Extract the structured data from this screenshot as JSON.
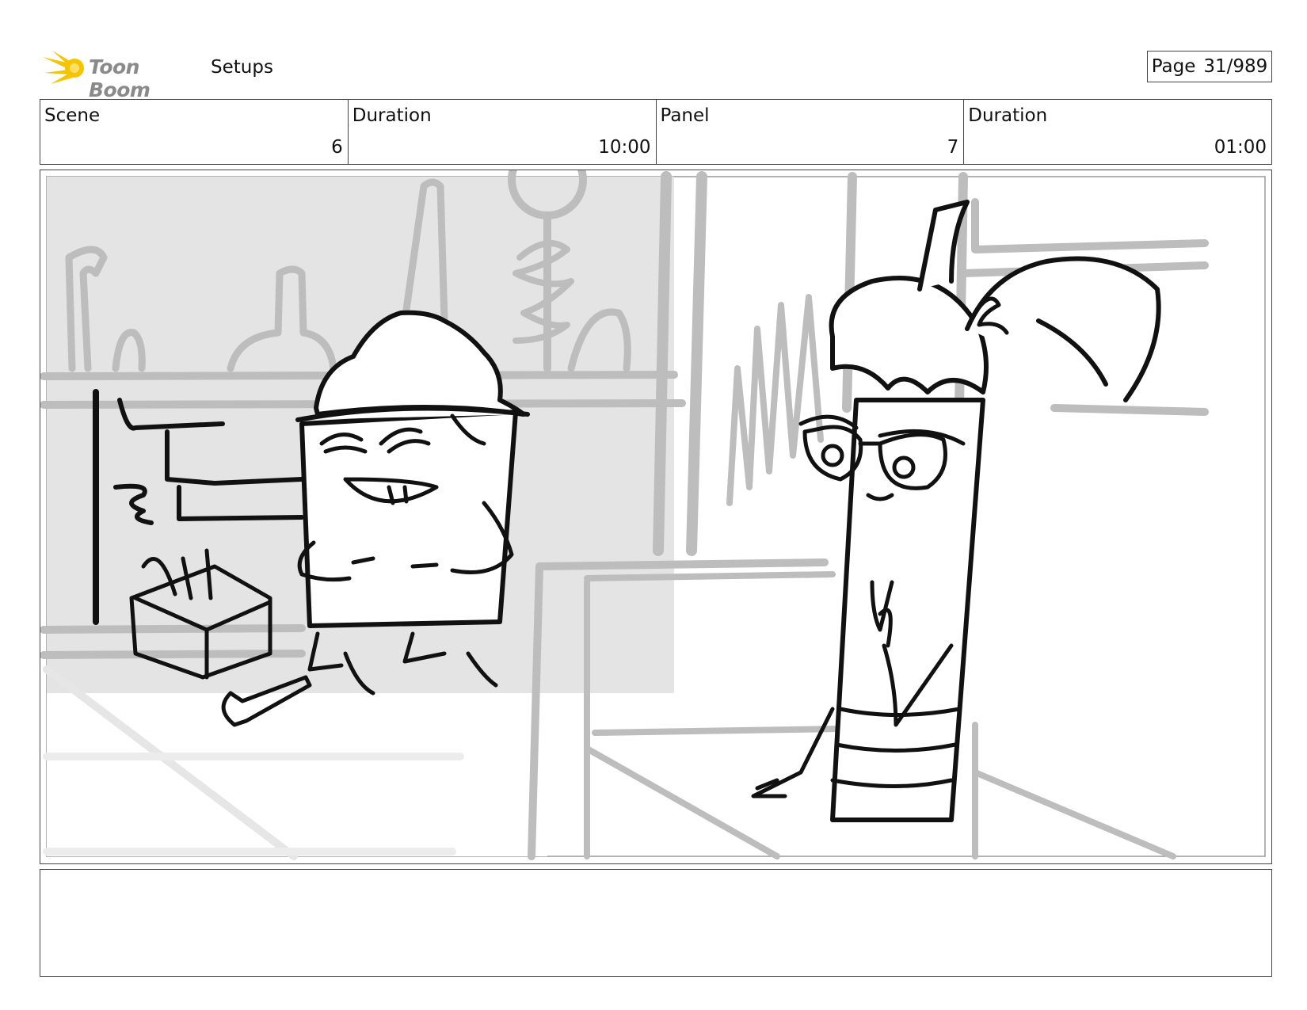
{
  "header": {
    "logo_text": "Toon Boom",
    "title": "Setups",
    "page_label": "Page",
    "page_value": "31/989"
  },
  "info": [
    {
      "label": "Scene",
      "value": "6"
    },
    {
      "label": "Duration",
      "value": "10:00"
    },
    {
      "label": "Panel",
      "value": "7"
    },
    {
      "label": "Duration",
      "value": "01:00"
    }
  ],
  "notes": {
    "text": ""
  },
  "colors": {
    "border": "#444444",
    "logo_accent": "#f5c400",
    "sketch_gray": "#bdbdbd",
    "bg_gray": "#e4e4e4"
  },
  "icons": {
    "logo": "toon-boom-logo"
  }
}
